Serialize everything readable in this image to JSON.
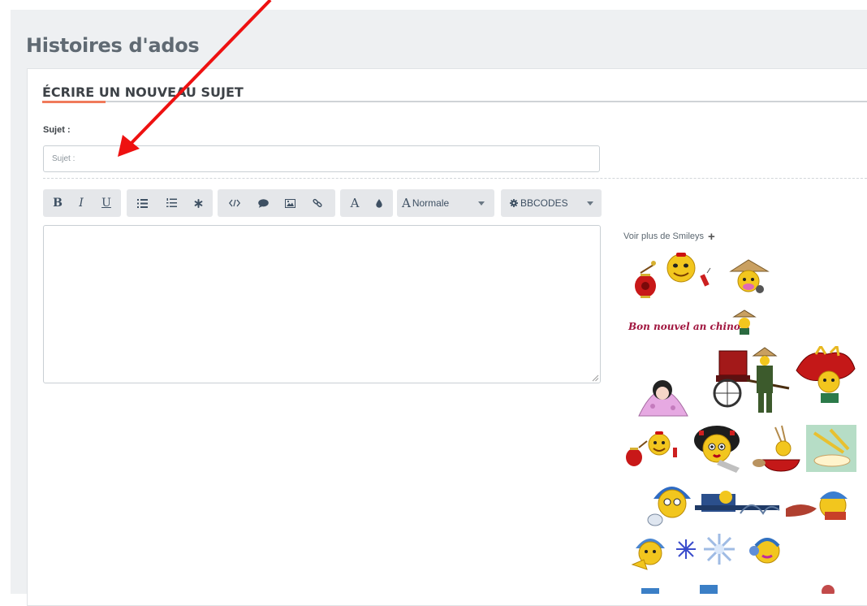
{
  "page": {
    "title": "Histoires d'ados"
  },
  "form": {
    "section_title": "ÉCRIRE UN NOUVEAU SUJET",
    "subject_label": "Sujet :",
    "subject_placeholder": "Sujet :",
    "subject_value": "",
    "message_value": ""
  },
  "toolbar": {
    "bold": "B",
    "italic": "I",
    "underline": "U",
    "color_letter": "A",
    "font_size": {
      "icon": "A",
      "selected": "Normale"
    },
    "bbcodes": "BBCODES"
  },
  "smileys": {
    "more_label": "Voir plus de Smileys",
    "plus_symbol": "+",
    "greeting_text": "Bon nouvel an chinois"
  },
  "colors": {
    "accent": "#f07a5b",
    "arrow": "#ee1111",
    "toolbar_bg": "#e5e7ea"
  }
}
